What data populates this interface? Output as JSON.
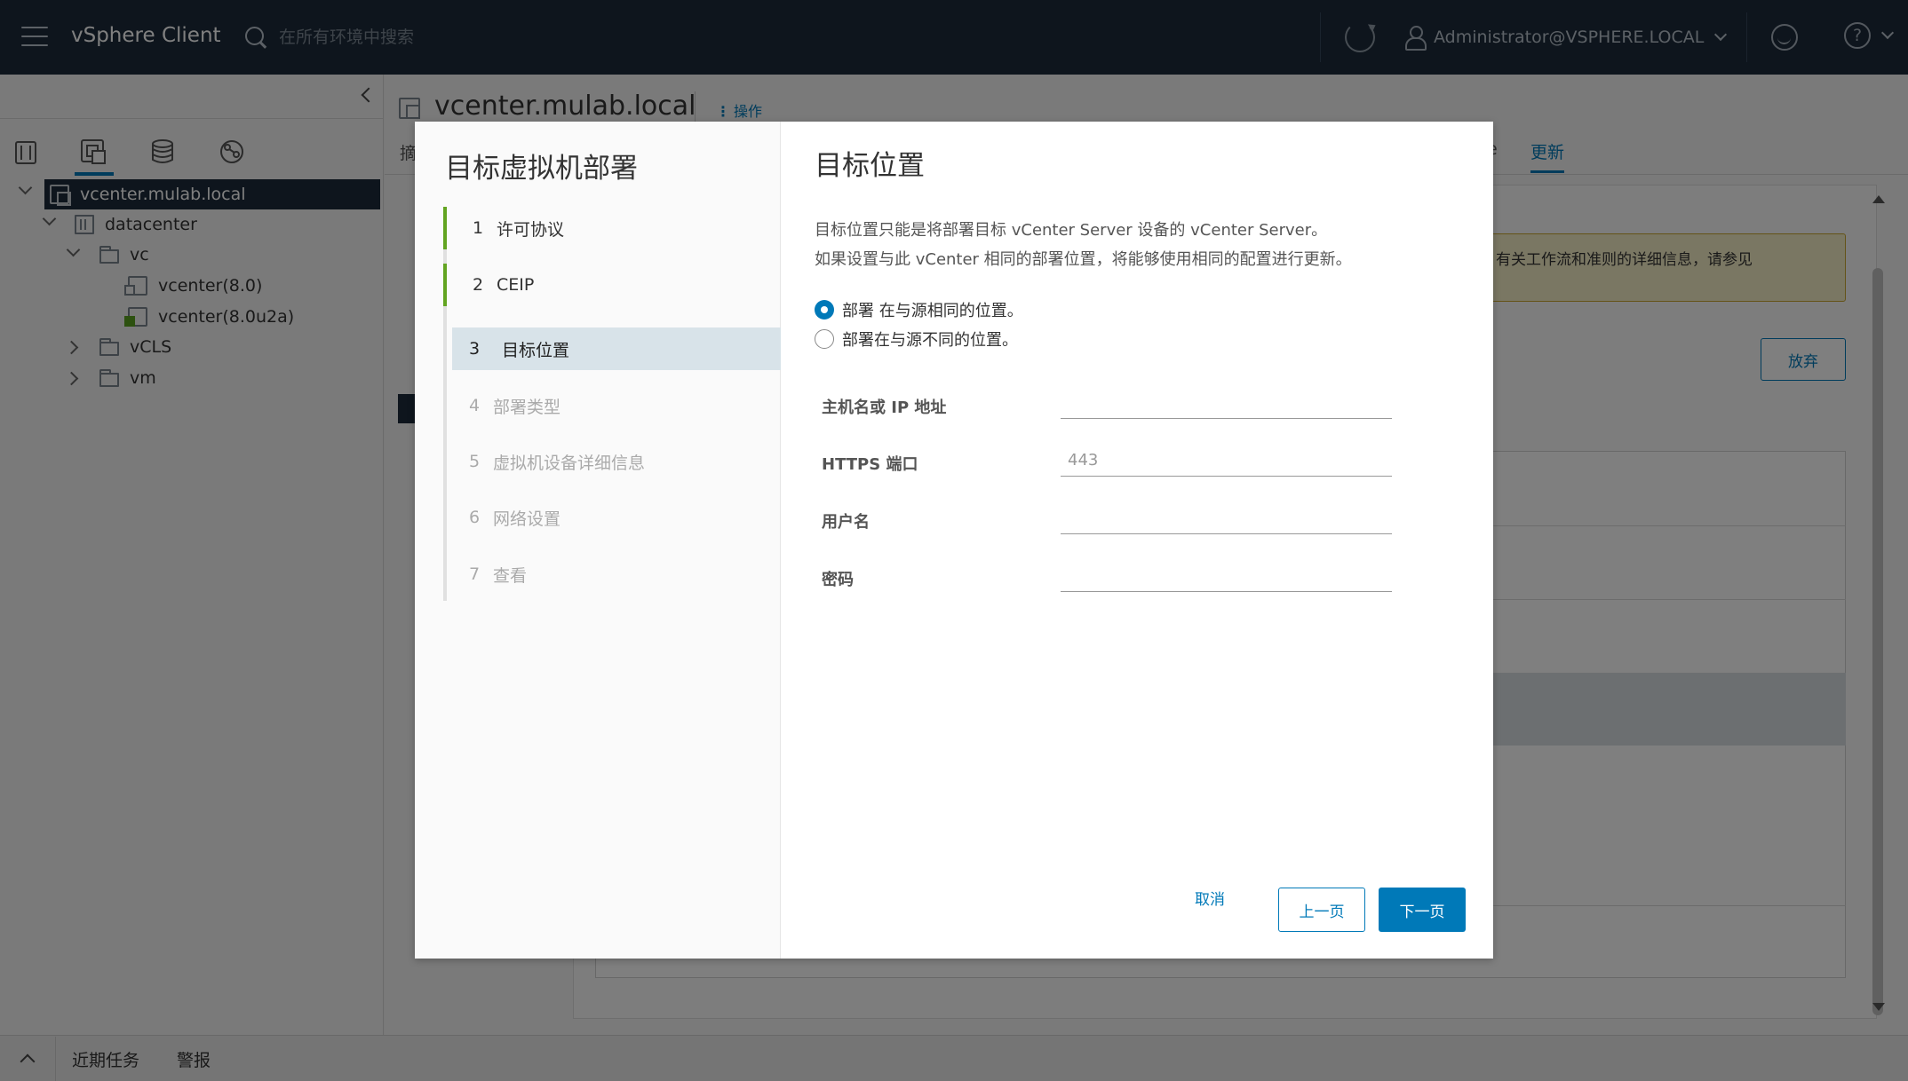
{
  "header": {
    "app_title": "vSphere Client",
    "search_placeholder": "在所有环境中搜索",
    "user": "Administrator@VSPHERE.LOCAL"
  },
  "nav": {
    "tabs": [
      {
        "name": "hosts-clusters",
        "icon": "hosts-icon",
        "active": false
      },
      {
        "name": "vms-templates",
        "icon": "vms-icon",
        "active": true
      },
      {
        "name": "storage",
        "icon": "storage-icon",
        "active": false
      },
      {
        "name": "networking",
        "icon": "network-icon",
        "active": false
      }
    ],
    "tree": [
      {
        "label": "vcenter.mulab.local",
        "icon": "vcenter-icon",
        "selected": true
      },
      {
        "label": "datacenter",
        "icon": "datacenter-icon"
      },
      {
        "label": "vc",
        "icon": "folder-icon"
      },
      {
        "label": "vcenter(8.0)",
        "icon": "vm-icon"
      },
      {
        "label": "vcenter(8.0u2a)",
        "icon": "vm-running-icon"
      },
      {
        "label": "vCLS",
        "icon": "folder-icon"
      },
      {
        "label": "vm",
        "icon": "folder-icon"
      }
    ]
  },
  "main": {
    "title": "vcenter.mulab.local",
    "actions": "操作",
    "first_tab_partial": "摘",
    "tab_other_partial": "e",
    "active_tab": "更新",
    "banner": "有关工作流和准则的详细信息，请参见",
    "abandon_button": "放弃"
  },
  "bottom": {
    "recent_tasks": "近期任务",
    "alarms": "警报"
  },
  "wizard": {
    "title": "目标虚拟机部署",
    "steps": [
      {
        "num": "1",
        "label": "许可协议",
        "state": "done"
      },
      {
        "num": "2",
        "label": "CEIP",
        "state": "done"
      },
      {
        "num": "3",
        "label": "目标位置",
        "state": "current"
      },
      {
        "num": "4",
        "label": "部署类型",
        "state": "todo"
      },
      {
        "num": "5",
        "label": "虚拟机设备详细信息",
        "state": "todo"
      },
      {
        "num": "6",
        "label": "网络设置",
        "state": "todo"
      },
      {
        "num": "7",
        "label": "查看",
        "state": "todo"
      }
    ],
    "page_title": "目标位置",
    "desc_line1": "目标位置只能是将部署目标 vCenter Server 设备的 vCenter Server。",
    "desc_line2": "如果设置与此 vCenter 相同的部署位置，将能够使用相同的配置进行更新。",
    "radio_same": "部署 在与源相同的位置。",
    "radio_different": "部署在与源不同的位置。",
    "fields": {
      "host_label": "主机名或 IP 地址",
      "host_value": "",
      "port_label": "HTTPS 端口",
      "port_placeholder": "443",
      "user_label": "用户名",
      "user_value": "",
      "password_label": "密码",
      "password_value": ""
    },
    "cancel": "取消",
    "back": "上一页",
    "next": "下一页"
  }
}
